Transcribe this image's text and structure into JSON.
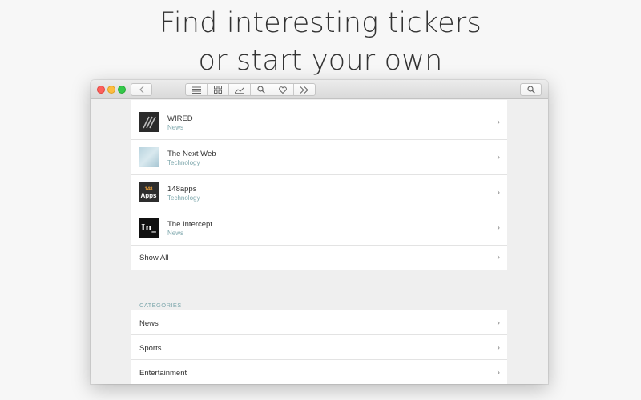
{
  "headline": {
    "line1": "Find interesting tickers",
    "line2": "or start your own"
  },
  "toolbar": {
    "back_icon": "chevron-left-icon",
    "segments": [
      "list-icon",
      "grid-icon",
      "chart-icon",
      "search-icon",
      "heart-icon",
      "forward-icon"
    ],
    "search_icon": "search-icon"
  },
  "feeds": [
    {
      "title": "WIRED",
      "category": "News",
      "icon": "wired-logo"
    },
    {
      "title": "The Next Web",
      "category": "Technology",
      "icon": "tnw-logo"
    },
    {
      "title": "148apps",
      "category": "Technology",
      "icon": "148apps-logo"
    },
    {
      "title": "The Intercept",
      "category": "News",
      "icon": "intercept-logo"
    }
  ],
  "show_all_label": "Show All",
  "logos": {
    "apps_top": "148",
    "apps_bottom": "Apps",
    "intercept": "In_"
  },
  "categories": {
    "header": "CATEGORIES",
    "items": [
      "News",
      "Sports",
      "Entertainment"
    ]
  },
  "colors": {
    "accent": "#7fa8ad",
    "traffic_red": "#fc605c",
    "traffic_yellow": "#fdbc40",
    "traffic_green": "#34c84a"
  }
}
